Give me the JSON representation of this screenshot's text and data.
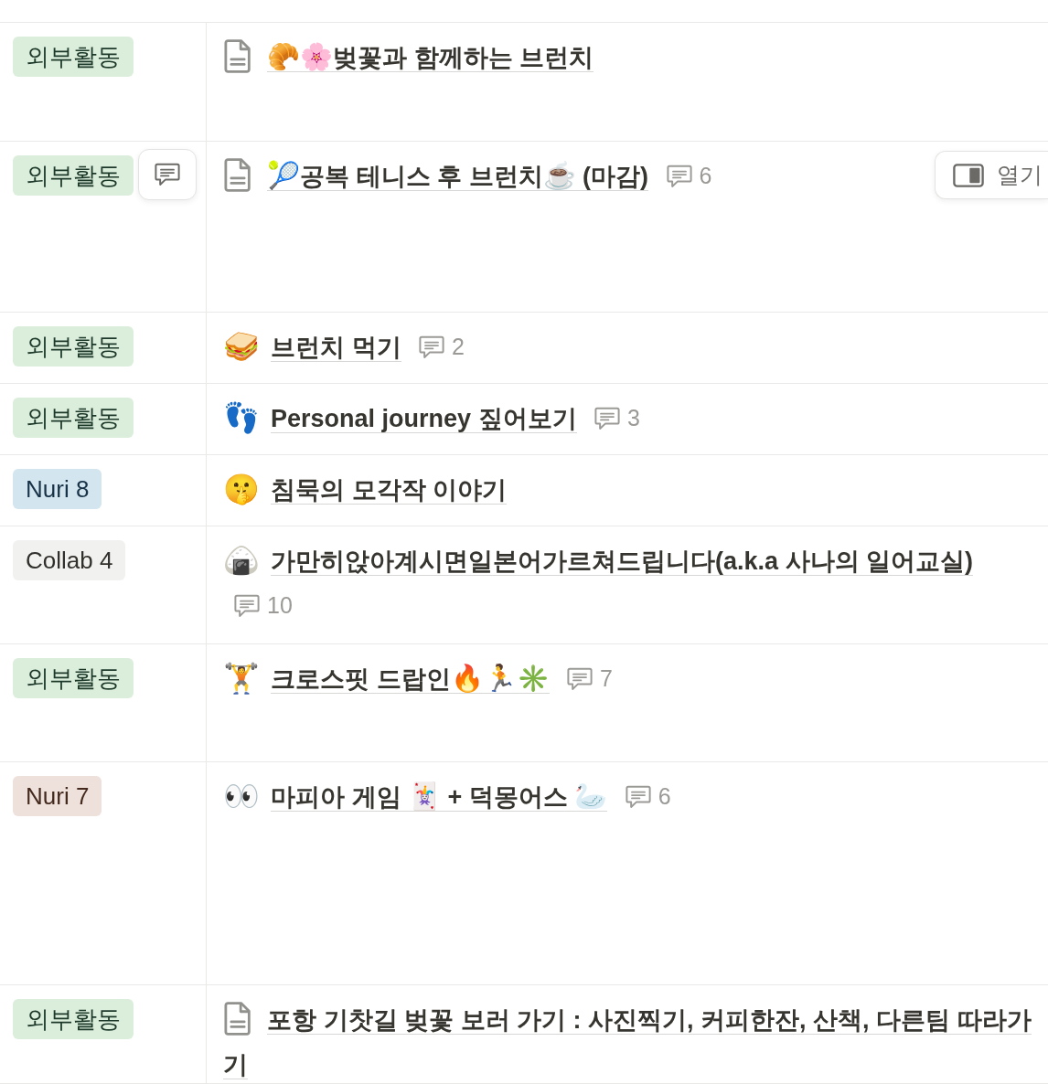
{
  "table": {
    "rows": [
      {
        "tag": {
          "label": "외부활동",
          "color": "#dbeddb"
        },
        "hovered": false,
        "page_icon": {
          "kind": "document"
        },
        "title": [
          {
            "kind": "emoji",
            "text": "🥐"
          },
          {
            "kind": "emoji",
            "text": "🌸"
          },
          {
            "kind": "text",
            "text": "벚꽃과 함께하는 브런치"
          }
        ]
      },
      {
        "tag": {
          "label": "외부활동",
          "color": "#dbeddb"
        },
        "hovered": true,
        "open_button": "열기",
        "page_icon": {
          "kind": "document"
        },
        "title": [
          {
            "kind": "emoji",
            "text": "🎾"
          },
          {
            "kind": "text",
            "text": "공복 테니스 후 브런치"
          },
          {
            "kind": "emoji",
            "text": "☕"
          },
          {
            "kind": "text",
            "text": " (마감)"
          }
        ],
        "comments": "6"
      },
      {
        "tag": {
          "label": "외부활동",
          "color": "#dbeddb"
        },
        "hovered": false,
        "page_icon": {
          "kind": "emoji",
          "text": "🥪"
        },
        "title": [
          {
            "kind": "text",
            "text": "브런치 먹기"
          }
        ],
        "comments": "2"
      },
      {
        "tag": {
          "label": "외부활동",
          "color": "#dbeddb"
        },
        "hovered": false,
        "page_icon": {
          "kind": "emoji",
          "text": "👣"
        },
        "title": [
          {
            "kind": "text",
            "text": "Personal journey 짚어보기"
          }
        ],
        "comments": "3"
      },
      {
        "tag": {
          "label": "Nuri 8",
          "color": "#d3e5ef"
        },
        "hovered": false,
        "page_icon": {
          "kind": "emoji",
          "text": "🤫"
        },
        "title": [
          {
            "kind": "text",
            "text": "침묵의 모각작 이야기"
          }
        ]
      },
      {
        "tag": {
          "label": "Collab 4",
          "color": "#f1f1ef"
        },
        "hovered": false,
        "page_icon": {
          "kind": "emoji",
          "text": "🍙"
        },
        "title": [
          {
            "kind": "text",
            "text": "가만히앉아계시면일본어가르쳐드립니다(a.k.a 사나의 일어교실)"
          }
        ],
        "comments": "10"
      },
      {
        "tag": {
          "label": "외부활동",
          "color": "#dbeddb"
        },
        "hovered": false,
        "page_icon": {
          "kind": "emoji",
          "text": "🏋️"
        },
        "title": [
          {
            "kind": "text",
            "text": "크로스핏 드랍인"
          },
          {
            "kind": "emoji",
            "text": "🔥"
          },
          {
            "kind": "emoji",
            "text": "🏃"
          },
          {
            "kind": "emoji",
            "text": "✳️"
          }
        ],
        "comments": "7"
      },
      {
        "tag": {
          "label": "Nuri 7",
          "color": "#eee0da"
        },
        "hovered": false,
        "page_icon": {
          "kind": "emoji",
          "text": "👀"
        },
        "title": [
          {
            "kind": "text",
            "text": "마피아 게임 "
          },
          {
            "kind": "emoji",
            "text": "🃏"
          },
          {
            "kind": "text",
            "text": " + 덕몽어스 "
          },
          {
            "kind": "emoji",
            "text": "🦢"
          }
        ],
        "comments": "6"
      },
      {
        "tag": {
          "label": "외부활동",
          "color": "#dbeddb"
        },
        "hovered": false,
        "page_icon": {
          "kind": "document"
        },
        "title": [
          {
            "kind": "text",
            "text": "포항 기찻길 벚꽃 보러 가기 : 사진찍기, 커피한잔, 산책, 다른팀 따라가기"
          }
        ]
      }
    ]
  }
}
